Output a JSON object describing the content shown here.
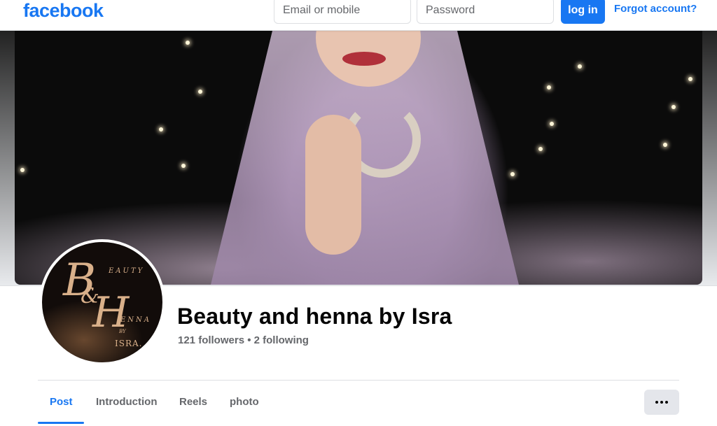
{
  "header": {
    "logo": "facebook",
    "email_placeholder": "Email or mobile",
    "password_placeholder": "Password",
    "login_label": "log in",
    "forgot_label": "Forgot account?"
  },
  "profile": {
    "name": "Beauty and henna by Isra",
    "followers_text": "121 followers • 2 following",
    "avatar_text": {
      "letter_b": "B",
      "ampersand": "&",
      "letter_h": "H",
      "word_eauty": "EAUTY",
      "word_enna": "ENNA",
      "by": "BY",
      "isra": "ISRA."
    }
  },
  "tabs": [
    {
      "label": "Post",
      "active": true
    },
    {
      "label": "Introduction",
      "active": false
    },
    {
      "label": "Reels",
      "active": false
    },
    {
      "label": "photo",
      "active": false
    }
  ],
  "colors": {
    "brand": "#1877f2",
    "text_secondary": "#65676b",
    "text_primary": "#050505"
  },
  "icons": {
    "more": "more-horizontal-icon"
  }
}
